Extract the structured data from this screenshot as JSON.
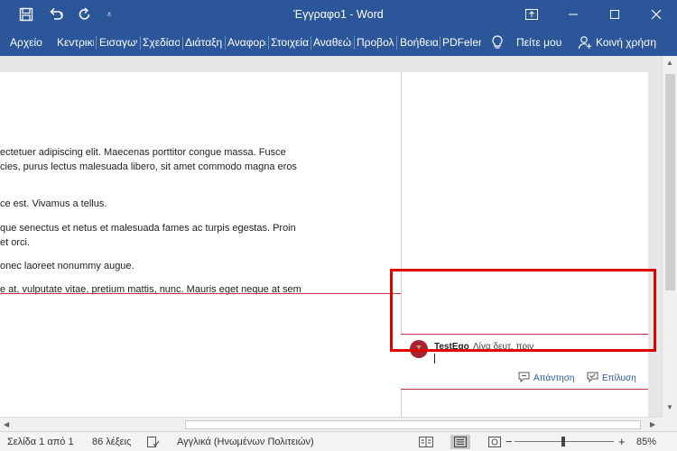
{
  "window": {
    "title": "Έγγραφο1 - Word",
    "accent": "#2b579a"
  },
  "quick_access": {
    "icons": [
      "save-icon",
      "undo-icon",
      "redo-icon",
      "customize-icon"
    ]
  },
  "ribbon": {
    "tabs": [
      "Αρχείο",
      "Κεντρική",
      "Εισαγωγή",
      "Σχεδίαση",
      "Διάταξη",
      "Αναφορές",
      "Στοιχεία",
      "Αναθεώρηση",
      "Προβολή",
      "Βοήθεια",
      "PDFelement"
    ],
    "tell_me": "Πείτε μου",
    "share": "Κοινή χρήση"
  },
  "document": {
    "paragraphs": [
      "ectetuer adipiscing elit. Maecenas porttitor congue massa. Fusce",
      "cies, purus lectus malesuada libero, sit amet commodo magna eros",
      "ce est. Vivamus a tellus.",
      "que senectus et netus et malesuada fames ac turpis egestas. Proin",
      "et orci.",
      "onec laoreet nonummy augue.",
      "e at, vulputate vitae, pretium mattis, nunc. Mauris eget neque at sem"
    ]
  },
  "comment": {
    "avatar_initial": "T",
    "author": "TestEgo",
    "time": "Λίγα δευτ. πριν",
    "reply_label": "Απάντηση",
    "resolve_label": "Επίλυση",
    "color": "#c4314b"
  },
  "statusbar": {
    "page": "Σελίδα 1 από 1",
    "words": "86 λέξεις",
    "language": "Αγγλικά (Ηνωμένων Πολιτειών)",
    "zoom": "85%"
  }
}
